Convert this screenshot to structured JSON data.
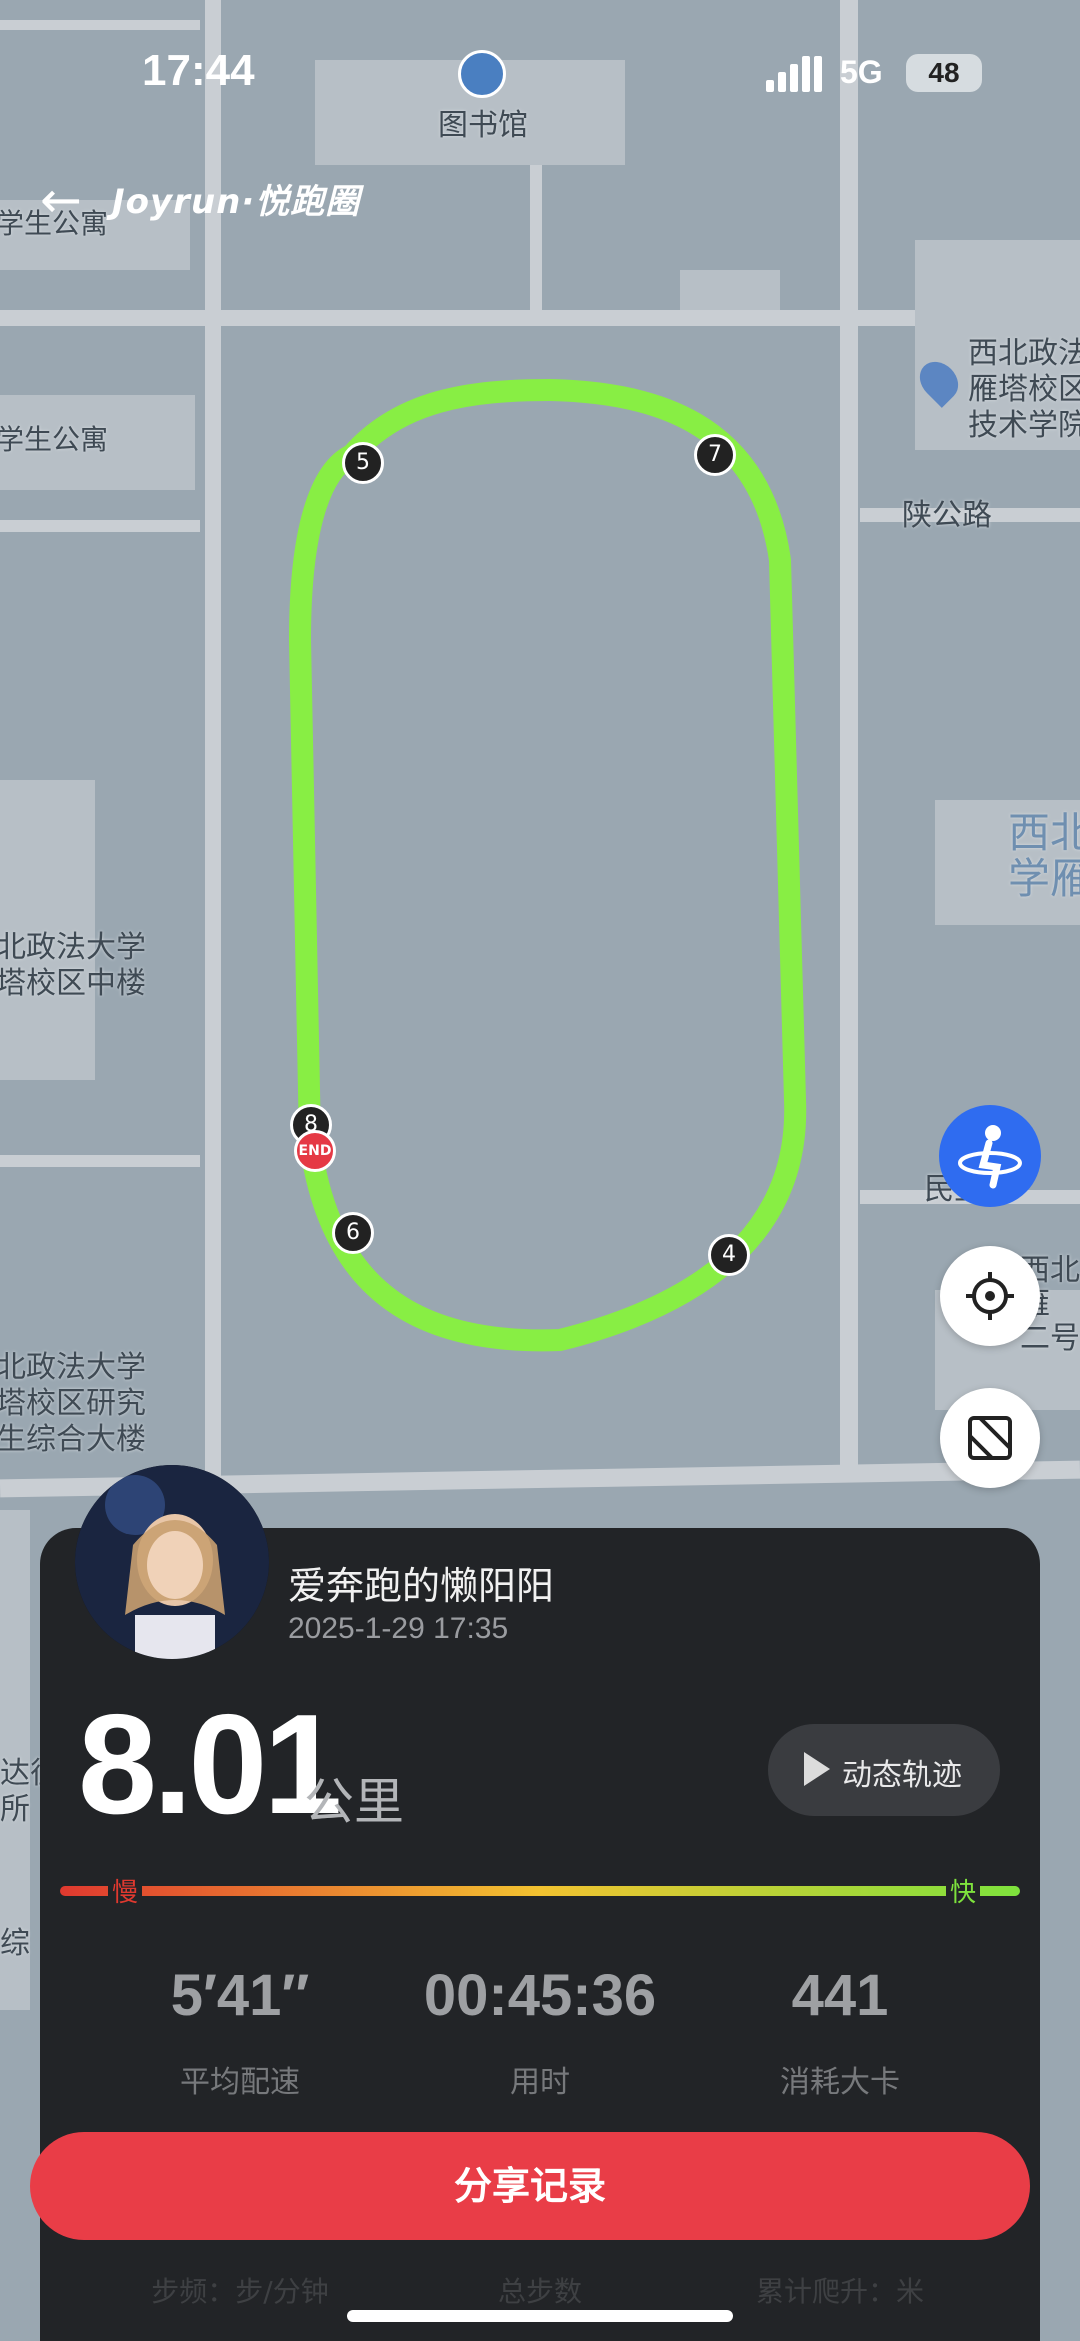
{
  "status_bar": {
    "time": "17:44",
    "network": "5G",
    "battery": "48"
  },
  "header": {
    "brand": "Joyrun·悦跑圈"
  },
  "map": {
    "labels": {
      "library": "图书馆",
      "apartment_top": "学生公寓",
      "apartment_mid": "学生公寓",
      "poi_right_top": "西北政法\n雁塔校区\n技术学院",
      "road_shaangong": "陕公路",
      "right_mid": "西北\n学雁",
      "left_mid": "北政法大学\n塔校区中楼",
      "left_bottom": "北政法大学\n塔校区研究\n生综合大楼",
      "road_min": "民主路",
      "right_low": "西北\n雁\n二号",
      "left_edge_1": "达征\n所",
      "left_edge_2": "综"
    },
    "km_markers": [
      "5",
      "7",
      "8",
      "6",
      "4"
    ],
    "end_marker": "END"
  },
  "profile": {
    "username": "爱奔跑的懒阳阳",
    "datetime": "2025-1-29 17:35"
  },
  "summary": {
    "distance": "8.01",
    "unit": "公里",
    "replay_label": "动态轨迹",
    "pace_slow": "慢",
    "pace_fast": "快",
    "colors": {
      "slow": "#e0392f",
      "mid": "#f2c230",
      "fast": "#7ee23d",
      "route": "#88ee44",
      "share": "#e93d47"
    }
  },
  "stats": [
    {
      "value": "5′41′′",
      "label": "平均配速"
    },
    {
      "value": "00:45:36",
      "label": "用时"
    },
    {
      "value": "441",
      "label": "消耗大卡"
    }
  ],
  "share_button": "分享记录",
  "more_stats": [
    "步频：步/分钟",
    "总步数",
    "累计爬升：米"
  ],
  "icons": {
    "runner": "runner-icon",
    "locate": "crosshair-icon",
    "layers": "map-layer-icon",
    "back": "back-arrow-icon",
    "play": "play-icon"
  }
}
